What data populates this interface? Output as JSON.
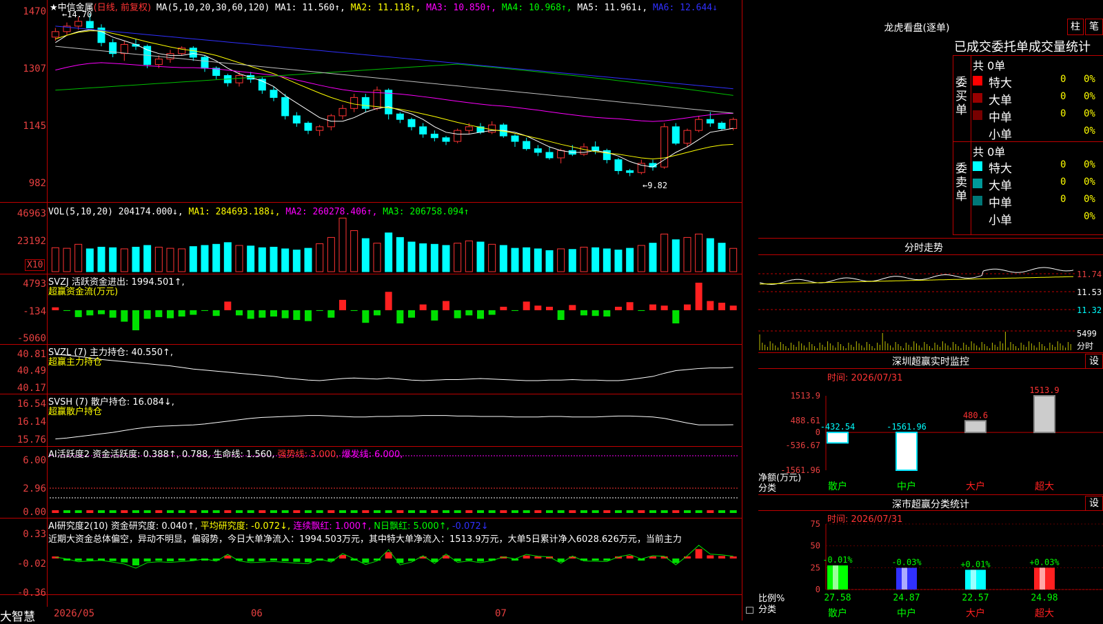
{
  "app_title": "大智慧",
  "stock": {
    "name": "★中信金属",
    "mode": "(日线, 前复权)"
  },
  "x_axis_labels": [
    "2026/05",
    "06",
    "07"
  ],
  "main_header": {
    "ma_params": "MA(5,10,20,30,60,120)",
    "ma1": "MA1: 11.560↑,",
    "ma2": "MA2: 11.118↑,",
    "ma3": "MA3: 10.850↑,",
    "ma4": "MA4: 10.968↑,",
    "ma5": "MA5: 11.961↓,",
    "ma6": "MA6: 12.644↓"
  },
  "price_annotations": {
    "high": "←14.70",
    "low": "←9.82"
  },
  "price_axis": [
    "1470",
    "1307",
    "1145",
    "982"
  ],
  "vol_header": {
    "params": "VOL(5,10,20)",
    "val": "204174.000↓,",
    "ma1": "MA1: 284693.188↓,",
    "ma2": "MA2: 260278.406↑,",
    "ma3": "MA3: 206758.094↑"
  },
  "vol_axis": [
    "46963",
    "23192",
    "X10"
  ],
  "svzj_header": {
    "name": "SVZJ",
    "label": "活跃资金进出: 1994.501↑,",
    "sub": "超赢资金流(万元)"
  },
  "svzj_axis": [
    "4793",
    "-134",
    "-5060"
  ],
  "svzl_header": {
    "name": "SVZL (7)",
    "label": "主力持仓: 40.550↑,",
    "sub": "超赢主力持仓"
  },
  "svzl_axis": [
    "40.81",
    "40.49",
    "40.17"
  ],
  "svsh_header": {
    "name": "SVSH (7)",
    "label": "散户持仓: 16.084↓,",
    "sub": "超赢散户持仓"
  },
  "svsh_axis": [
    "16.54",
    "16.14",
    "15.76"
  ],
  "ai_active_header": {
    "name": "AI活跃度2",
    "label": "资金活跃度: 0.388↑, 0.788,",
    "life": "生命线: 1.560,",
    "strong": "强势线: 3.000,",
    "burst": "爆发线: 6.000,"
  },
  "ai_active_axis": [
    "6.00",
    "2.96",
    "0.00"
  ],
  "ai_research_header": {
    "name": "AI研究度2(10)",
    "label": "资金研究度: 0.040↑,",
    "avg": "平均研究度: -0.072↓,",
    "red": "连续飘红: 1.000↑,",
    "nred": "N日飘红: 5.000↑,",
    "last": "-0.072↓"
  },
  "ai_research_text": "近期大资金总体偏空，异动不明显，偏弱势，今日大单净流入：1994.503万元，其中特大单净流入：1513.9万元，大单5日累计净入6028.626万元，当前主力",
  "ai_research_axis": [
    "0.33",
    "-0.02",
    "-0.36"
  ],
  "right_panel": {
    "dragon_title": "龙虎看盘(逐单)",
    "btn_zhu": "柱",
    "btn_bi": "笔",
    "order_stats_title": "已成交委托单成交量统计",
    "buy_label": "委买单",
    "sell_label": "委卖单",
    "buy_total": "共 0单",
    "sell_total": "共 0单",
    "categories": [
      "特大",
      "大单",
      "中单",
      "小单"
    ],
    "buy_values": [
      "0",
      "0",
      "0",
      ""
    ],
    "buy_pcts": [
      "0%",
      "0%",
      "0%",
      "0%"
    ],
    "sell_values": [
      "0",
      "0",
      "0",
      ""
    ],
    "sell_pcts": [
      "0%",
      "0%",
      "0%",
      "0%"
    ],
    "intraday_title": "分时走势",
    "intraday_axis": [
      "11.74",
      "11.53",
      "11.32",
      "5499",
      "分时"
    ],
    "sz_monitor_title": "深圳超赢实时监控",
    "sz_monitor_time": "时间: 2026/07/31",
    "sz_monitor_axis": [
      "1513.9",
      "488.61",
      "0",
      "-536.67",
      "-1561.96"
    ],
    "sz_monitor_ylabel": "净额(万元)",
    "sz_monitor_xlabel": "分类",
    "sz_classify_title": "深市超赢分类统计",
    "sz_classify_time": "时间: 2026/07/31",
    "sz_classify_axis": [
      "75",
      "50",
      "25",
      "0"
    ],
    "sz_classify_ylabel": "比例%",
    "sz_classify_xlabel": "分类",
    "settings_btn": "设"
  },
  "colors": {
    "up": "#ff3333",
    "down": "#00ffff",
    "border": "#c00000",
    "ma1": "#ffffff",
    "ma2": "#ffff00",
    "ma3": "#ff00ff",
    "ma4": "#00c000",
    "ma5": "#c0c0c0",
    "ma6": "#3030ff"
  },
  "chart_data": [
    {
      "type": "candlestick",
      "title": "中信金属 (日线, 前复权)",
      "x": [
        "2026/05",
        "",
        "",
        "",
        "",
        "",
        "",
        "",
        "",
        "",
        "",
        "",
        "",
        "",
        "",
        "",
        "",
        "",
        "",
        "",
        "",
        "",
        "06",
        "",
        "",
        "",
        "",
        "",
        "",
        "",
        "",
        "",
        "",
        "",
        "",
        "",
        "",
        "",
        "",
        "",
        "",
        "",
        "",
        "",
        "07",
        "",
        "",
        "",
        "",
        "",
        "",
        "",
        "",
        "",
        "",
        "",
        "",
        "",
        "",
        "",
        "",
        "",
        "",
        "",
        "",
        "",
        ""
      ],
      "ohlc": [
        [
          14.05,
          14.3,
          13.95,
          14.2
        ],
        [
          14.2,
          14.45,
          14.1,
          14.35
        ],
        [
          14.35,
          14.6,
          14.25,
          14.48
        ],
        [
          14.48,
          14.7,
          14.4,
          14.3
        ],
        [
          14.3,
          14.4,
          13.8,
          13.9
        ],
        [
          13.9,
          14.0,
          13.5,
          13.6
        ],
        [
          13.6,
          13.95,
          13.4,
          13.85
        ],
        [
          13.85,
          14.0,
          13.7,
          13.8
        ],
        [
          13.8,
          13.85,
          13.2,
          13.3
        ],
        [
          13.3,
          13.55,
          13.2,
          13.45
        ],
        [
          13.45,
          13.7,
          13.35,
          13.6
        ],
        [
          13.6,
          13.8,
          13.55,
          13.75
        ],
        [
          13.75,
          13.8,
          13.4,
          13.5
        ],
        [
          13.5,
          13.55,
          13.1,
          13.2
        ],
        [
          13.2,
          13.25,
          12.9,
          13.0
        ],
        [
          13.0,
          13.05,
          12.7,
          12.8
        ],
        [
          12.8,
          13.1,
          12.7,
          13.0
        ],
        [
          13.0,
          13.1,
          12.8,
          12.9
        ],
        [
          12.9,
          12.95,
          12.5,
          12.6
        ],
        [
          12.6,
          12.7,
          12.3,
          12.4
        ],
        [
          12.4,
          12.5,
          11.8,
          11.9
        ],
        [
          11.9,
          12.0,
          11.6,
          11.7
        ],
        [
          11.7,
          11.75,
          11.4,
          11.5
        ],
        [
          11.5,
          11.65,
          11.35,
          11.6
        ],
        [
          11.6,
          11.95,
          11.5,
          11.9
        ],
        [
          11.9,
          12.2,
          11.8,
          12.1
        ],
        [
          12.1,
          12.5,
          12.0,
          12.4
        ],
        [
          12.4,
          12.5,
          12.0,
          12.1
        ],
        [
          12.1,
          12.7,
          12.05,
          12.6
        ],
        [
          12.6,
          12.65,
          11.8,
          11.95
        ],
        [
          11.95,
          12.0,
          11.7,
          11.8
        ],
        [
          11.8,
          11.85,
          11.5,
          11.6
        ],
        [
          11.6,
          11.7,
          11.3,
          11.4
        ],
        [
          11.4,
          11.5,
          11.2,
          11.3
        ],
        [
          11.3,
          11.35,
          11.1,
          11.2
        ],
        [
          11.2,
          11.55,
          11.15,
          11.5
        ],
        [
          11.5,
          11.7,
          11.4,
          11.6
        ],
        [
          11.6,
          11.7,
          11.4,
          11.45
        ],
        [
          11.45,
          11.75,
          11.4,
          11.65
        ],
        [
          11.65,
          11.7,
          11.3,
          11.35
        ],
        [
          11.35,
          11.4,
          11.05,
          11.2
        ],
        [
          11.2,
          11.3,
          10.95,
          11.0
        ],
        [
          11.0,
          11.1,
          10.8,
          10.9
        ],
        [
          10.9,
          11.05,
          10.7,
          10.75
        ],
        [
          10.75,
          11.0,
          10.6,
          10.95
        ],
        [
          10.95,
          11.1,
          10.8,
          10.85
        ],
        [
          10.85,
          11.15,
          10.8,
          11.05
        ],
        [
          11.05,
          11.2,
          10.85,
          10.95
        ],
        [
          10.95,
          11.0,
          10.6,
          10.7
        ],
        [
          10.7,
          10.75,
          10.3,
          10.4
        ],
        [
          10.4,
          10.45,
          10.25,
          10.35
        ],
        [
          10.35,
          10.7,
          10.3,
          10.6
        ],
        [
          10.6,
          10.7,
          10.4,
          10.5
        ],
        [
          10.5,
          11.7,
          10.45,
          11.6
        ],
        [
          11.6,
          11.7,
          11.1,
          11.15
        ],
        [
          11.15,
          11.55,
          11.05,
          11.5
        ],
        [
          11.5,
          11.9,
          11.45,
          11.8
        ],
        [
          11.8,
          12.0,
          11.6,
          11.7
        ],
        [
          11.7,
          11.75,
          11.5,
          11.55
        ],
        [
          11.55,
          11.85,
          11.5,
          11.8
        ]
      ],
      "moving_averages": {
        "MA1": [
          13.9,
          14.1,
          14.2,
          14.25,
          14.2,
          14.05,
          13.95,
          13.85,
          13.7,
          13.6,
          13.55,
          13.55,
          13.6,
          13.55,
          13.4,
          13.2,
          13.05,
          12.95,
          12.85,
          12.7,
          12.45,
          12.25,
          12.05,
          11.85,
          11.75,
          11.75,
          11.85,
          12.0,
          12.1,
          12.15,
          12.05,
          11.95,
          11.8,
          11.6,
          11.45,
          11.4,
          11.4,
          11.45,
          11.5,
          11.5,
          11.45,
          11.35,
          11.2,
          11.05,
          10.95,
          10.9,
          10.9,
          10.95,
          10.9,
          10.8,
          10.65,
          10.55,
          10.5,
          10.7,
          10.9,
          11.05,
          11.25,
          11.45,
          11.5,
          11.56
        ],
        "MA2": [
          14.0,
          14.1,
          14.18,
          14.22,
          14.22,
          14.15,
          14.08,
          14.0,
          13.92,
          13.85,
          13.78,
          13.72,
          13.68,
          13.62,
          13.55,
          13.45,
          13.35,
          13.25,
          13.15,
          13.05,
          12.92,
          12.78,
          12.65,
          12.52,
          12.4,
          12.3,
          12.22,
          12.18,
          12.15,
          12.12,
          12.08,
          12.02,
          11.95,
          11.88,
          11.8,
          11.72,
          11.65,
          11.58,
          11.52,
          11.48,
          11.42,
          11.35,
          11.28,
          11.2,
          11.12,
          11.05,
          10.98,
          10.92,
          10.88,
          10.85,
          10.8,
          10.75,
          10.72,
          10.75,
          10.82,
          10.9,
          10.98,
          11.05,
          11.1,
          11.12
        ]
      },
      "ylim": [
        9.6,
        14.8
      ],
      "annotations": [
        "←14.70",
        "←9.82"
      ]
    },
    {
      "type": "bar",
      "title": "VOL(5,10,20)",
      "values": [
        210000,
        205000,
        240000,
        200000,
        215000,
        210000,
        200000,
        215000,
        230000,
        215000,
        205000,
        200000,
        220000,
        230000,
        240000,
        255000,
        230000,
        225000,
        210000,
        215000,
        200000,
        190000,
        205000,
        245000,
        300000,
        470000,
        360000,
        290000,
        250000,
        340000,
        300000,
        260000,
        245000,
        240000,
        230000,
        250000,
        270000,
        260000,
        240000,
        230000,
        205000,
        210000,
        200000,
        185000,
        200000,
        195000,
        215000,
        210000,
        200000,
        190000,
        205000,
        230000,
        250000,
        330000,
        280000,
        300000,
        330000,
        290000,
        250000,
        204174
      ],
      "ylim": [
        0,
        520000
      ]
    },
    {
      "type": "bar",
      "title": "SVZJ 超赢资金流(万元)",
      "values": [
        500,
        -134,
        -1200,
        -900,
        -700,
        -1300,
        -2000,
        -3500,
        -1500,
        -1200,
        -1400,
        -1100,
        -800,
        -134,
        -1000,
        1500,
        -900,
        -1500,
        -1300,
        -1100,
        -1400,
        -1700,
        -1900,
        -134,
        -1300,
        1800,
        -134,
        -2200,
        -900,
        3200,
        -2300,
        -1300,
        1000,
        -1800,
        1600,
        -1400,
        -900,
        -1500,
        -800,
        600,
        -134,
        1500,
        800,
        600,
        -1700,
        900,
        -900,
        -1000,
        -1100,
        600,
        1400,
        -134,
        1000,
        800,
        -2300,
        1000,
        4793,
        1600,
        1300,
        800,
        -134,
        1700
      ],
      "ylim": [
        -5060,
        4793
      ]
    },
    {
      "type": "line",
      "title": "SVZL 主力持仓",
      "values": [
        40.8,
        40.78,
        40.76,
        40.73,
        40.7,
        40.68,
        40.66,
        40.64,
        40.62,
        40.6,
        40.58,
        40.55,
        40.52,
        40.5,
        40.48,
        40.46,
        40.44,
        40.42,
        40.4,
        40.38,
        40.35,
        40.33,
        40.31,
        40.3,
        40.32,
        40.34,
        40.35,
        40.34,
        40.33,
        40.35,
        40.33,
        40.31,
        40.3,
        40.31,
        40.32,
        40.32,
        40.33,
        40.34,
        40.33,
        40.32,
        40.31,
        40.3,
        40.3,
        40.31,
        40.31,
        40.32,
        40.31,
        40.31,
        40.3,
        40.3,
        40.32,
        40.35,
        40.38,
        40.44,
        40.49,
        40.51,
        40.53,
        40.54,
        40.54,
        40.55
      ],
      "ylim": [
        40.17,
        40.81
      ]
    },
    {
      "type": "line",
      "title": "SVSH 散户持仓",
      "values": [
        15.78,
        15.8,
        15.83,
        15.86,
        15.89,
        15.92,
        15.96,
        16.0,
        16.03,
        16.05,
        16.06,
        16.07,
        16.08,
        16.1,
        16.13,
        16.16,
        16.19,
        16.22,
        16.24,
        16.25,
        16.26,
        16.27,
        16.28,
        16.28,
        16.27,
        16.26,
        16.25,
        16.25,
        16.26,
        16.26,
        16.27,
        16.27,
        16.28,
        16.28,
        16.28,
        16.27,
        16.27,
        16.26,
        16.26,
        16.26,
        16.25,
        16.25,
        16.25,
        16.26,
        16.26,
        16.25,
        16.25,
        16.25,
        16.26,
        16.27,
        16.27,
        16.26,
        16.25,
        16.22,
        16.17,
        16.12,
        16.08,
        16.08,
        16.08,
        16.084
      ],
      "ylim": [
        15.76,
        16.54
      ]
    },
    {
      "type": "bar",
      "title": "深圳超赢实时监控",
      "categories": [
        "散户",
        "中户",
        "大户",
        "超大"
      ],
      "values": [
        -432.54,
        -1561.96,
        480.6,
        1513.9
      ],
      "value_labels": [
        "-432.54",
        "-1561.96",
        "480.6",
        "1513.9"
      ],
      "ylabel": "净额(万元)",
      "xlabel": "分类",
      "ylim": [
        -1561.96,
        1513.9
      ]
    },
    {
      "type": "bar",
      "title": "深市超赢分类统计",
      "categories": [
        "散户",
        "中户",
        "大户",
        "超大"
      ],
      "values": [
        27.58,
        24.87,
        22.57,
        24.98
      ],
      "value_labels": [
        "-0.01%",
        "-0.03%",
        "+0.01%",
        "+0.03%"
      ],
      "ylabel": "比例%",
      "xlabel": "分类",
      "ylim": [
        0,
        75
      ]
    }
  ]
}
